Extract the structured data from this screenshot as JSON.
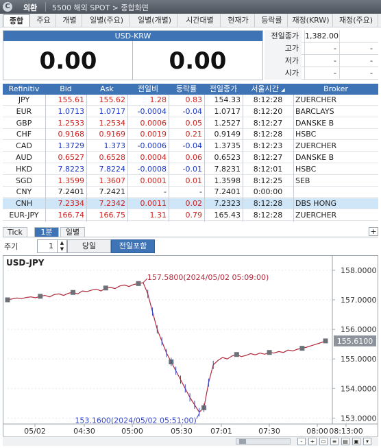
{
  "titlebar": {
    "category": "외환",
    "screen": "5500 해외 SPOT > 종합화면"
  },
  "tabs": [
    "종합",
    "주요",
    "개별",
    "일별(주요)",
    "일별(개별)",
    "시간대별",
    "현재가",
    "등락률",
    "재정(KRW)",
    "재정(주요)"
  ],
  "quote": {
    "pair": "USD-KRW",
    "bid": "0.00",
    "ask": "0.00",
    "side": [
      {
        "label": "전일종가",
        "v1": "1,382.00",
        "v2": ""
      },
      {
        "label": "고가",
        "v1": "-",
        "v2": "-"
      },
      {
        "label": "저가",
        "v1": "-",
        "v2": "-"
      },
      {
        "label": "시가",
        "v1": "-",
        "v2": "-"
      }
    ]
  },
  "table": {
    "headers": [
      "Refinitiv",
      "Bid",
      "Ask",
      "전일비",
      "등락률",
      "전일종가",
      "서울시간",
      "Broker"
    ],
    "rows": [
      {
        "name": "JPY",
        "bid": "155.61",
        "ask": "155.62",
        "chg": "1.28",
        "pct": "0.83",
        "prev": "154.33",
        "time": "8:12:28",
        "broker": "ZUERCHER",
        "color": "red"
      },
      {
        "name": "EUR",
        "bid": "1.0713",
        "ask": "1.0717",
        "chg": "-0.0004",
        "pct": "-0.04",
        "prev": "1.0717",
        "time": "8:12:20",
        "broker": "BARCLAYS",
        "color": "blue"
      },
      {
        "name": "GBP",
        "bid": "1.2533",
        "ask": "1.2534",
        "chg": "0.0006",
        "pct": "0.05",
        "prev": "1.2527",
        "time": "8:12:27",
        "broker": "DANSKE B",
        "color": "red"
      },
      {
        "name": "CHF",
        "bid": "0.9168",
        "ask": "0.9169",
        "chg": "0.0019",
        "pct": "0.21",
        "prev": "0.9149",
        "time": "8:12:28",
        "broker": "HSBC",
        "color": "red"
      },
      {
        "name": "CAD",
        "bid": "1.3729",
        "ask": "1.373",
        "chg": "-0.0006",
        "pct": "-0.04",
        "prev": "1.3735",
        "time": "8:12:23",
        "broker": "ZUERCHER",
        "color": "blue"
      },
      {
        "name": "AUD",
        "bid": "0.6527",
        "ask": "0.6528",
        "chg": "0.0004",
        "pct": "0.06",
        "prev": "0.6523",
        "time": "8:12:27",
        "broker": "DANSKE B",
        "color": "red"
      },
      {
        "name": "HKD",
        "bid": "7.8223",
        "ask": "7.8224",
        "chg": "-0.0008",
        "pct": "-0.01",
        "prev": "7.8231",
        "time": "8:12:01",
        "broker": "HSBC",
        "color": "blue"
      },
      {
        "name": "SGD",
        "bid": "1.3599",
        "ask": "1.3607",
        "chg": "0.0001",
        "pct": "0.01",
        "prev": "1.3598",
        "time": "8:12:25",
        "broker": "SEB",
        "color": "red"
      },
      {
        "name": "CNY",
        "bid": "7.2401",
        "ask": "7.2421",
        "chg": "-",
        "pct": "-",
        "prev": "7.2401",
        "time": "0:00:00",
        "broker": "",
        "color": "black"
      },
      {
        "name": "CNH",
        "bid": "7.2334",
        "ask": "7.2342",
        "chg": "0.0011",
        "pct": "0.02",
        "prev": "7.2323",
        "time": "8:12:28",
        "broker": "DBS HONG",
        "color": "red"
      },
      {
        "name": "EUR-JPY",
        "bid": "166.74",
        "ask": "166.75",
        "chg": "1.31",
        "pct": "0.79",
        "prev": "165.43",
        "time": "8:12:28",
        "broker": "ZUERCHER",
        "color": "red"
      }
    ]
  },
  "chart_tabs": [
    "Tick",
    "1분",
    "일별"
  ],
  "controls": {
    "period_label": "주기",
    "period_value": "1",
    "btn_today": "당일",
    "btn_incl_prev": "전일포함"
  },
  "chart_data": {
    "type": "line",
    "title": "USD-JPY",
    "ylim": [
      152.8,
      158.3
    ],
    "y_ticks": [
      "158.0000",
      "157.0000",
      "156.0000",
      "155.0000",
      "154.0000",
      "153.0000"
    ],
    "x_ticks": [
      "05/02",
      "04:30",
      "05:00",
      "05:30",
      "07:01",
      "07:30",
      "08:00",
      "08:13:00"
    ],
    "current": "155.6100",
    "annotations": [
      {
        "text": "157.5800(2024/05/02 05:09:00)",
        "value": 157.58
      },
      {
        "text": "153.1600(2024/05/02 05:51:00)",
        "value": 153.16
      }
    ],
    "series": [
      {
        "values": [
          157.0,
          157.03,
          157.06,
          157.04,
          157.08,
          157.1,
          157.07,
          157.12,
          157.15,
          157.1,
          157.18,
          157.2,
          157.15,
          157.22,
          157.25,
          157.2,
          157.3,
          157.28,
          157.33,
          157.36,
          157.3,
          157.4,
          157.42,
          157.38,
          157.47,
          157.5,
          157.45,
          157.52,
          157.55,
          157.58,
          157.2,
          156.6,
          156.0,
          155.6,
          155.2,
          154.9,
          154.6,
          154.3,
          154.0,
          153.7,
          153.45,
          153.2,
          153.35,
          154.2,
          154.8,
          154.95,
          155.05,
          155.0,
          155.1,
          155.15,
          155.08,
          155.12,
          155.18,
          155.14,
          155.2,
          155.16,
          155.22,
          155.2,
          155.25,
          155.22,
          155.3,
          155.27,
          155.33,
          155.36,
          155.4,
          155.45,
          155.5,
          155.55,
          155.61
        ]
      }
    ]
  }
}
